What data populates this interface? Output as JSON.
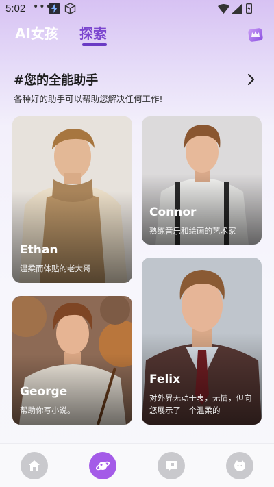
{
  "status_bar": {
    "time": "5:02",
    "dots": "•••"
  },
  "header": {
    "tabs": [
      {
        "label": "AI女孩",
        "active": false
      },
      {
        "label": "探索",
        "active": true
      }
    ],
    "accent_color": "#6a3bc4"
  },
  "section": {
    "title": "#您的全能助手",
    "subtitle": "各种好的助手可以帮助您解决任何工作!"
  },
  "cards": [
    {
      "name": "Ethan",
      "description": "温柔而体贴的老大哥"
    },
    {
      "name": "Connor",
      "description": "熟练音乐和绘画的艺术家"
    },
    {
      "name": "George",
      "description": "帮助你写小说。"
    },
    {
      "name": "Felix",
      "description": "对外界无动于衷，无情，但向您展示了一个温柔的"
    }
  ],
  "bottom_nav": {
    "items": [
      {
        "icon": "home-icon",
        "active": false
      },
      {
        "icon": "planet-icon",
        "active": true
      },
      {
        "icon": "chat-icon",
        "active": false
      },
      {
        "icon": "face-icon",
        "active": false
      }
    ],
    "active_color": "#a45be8"
  }
}
